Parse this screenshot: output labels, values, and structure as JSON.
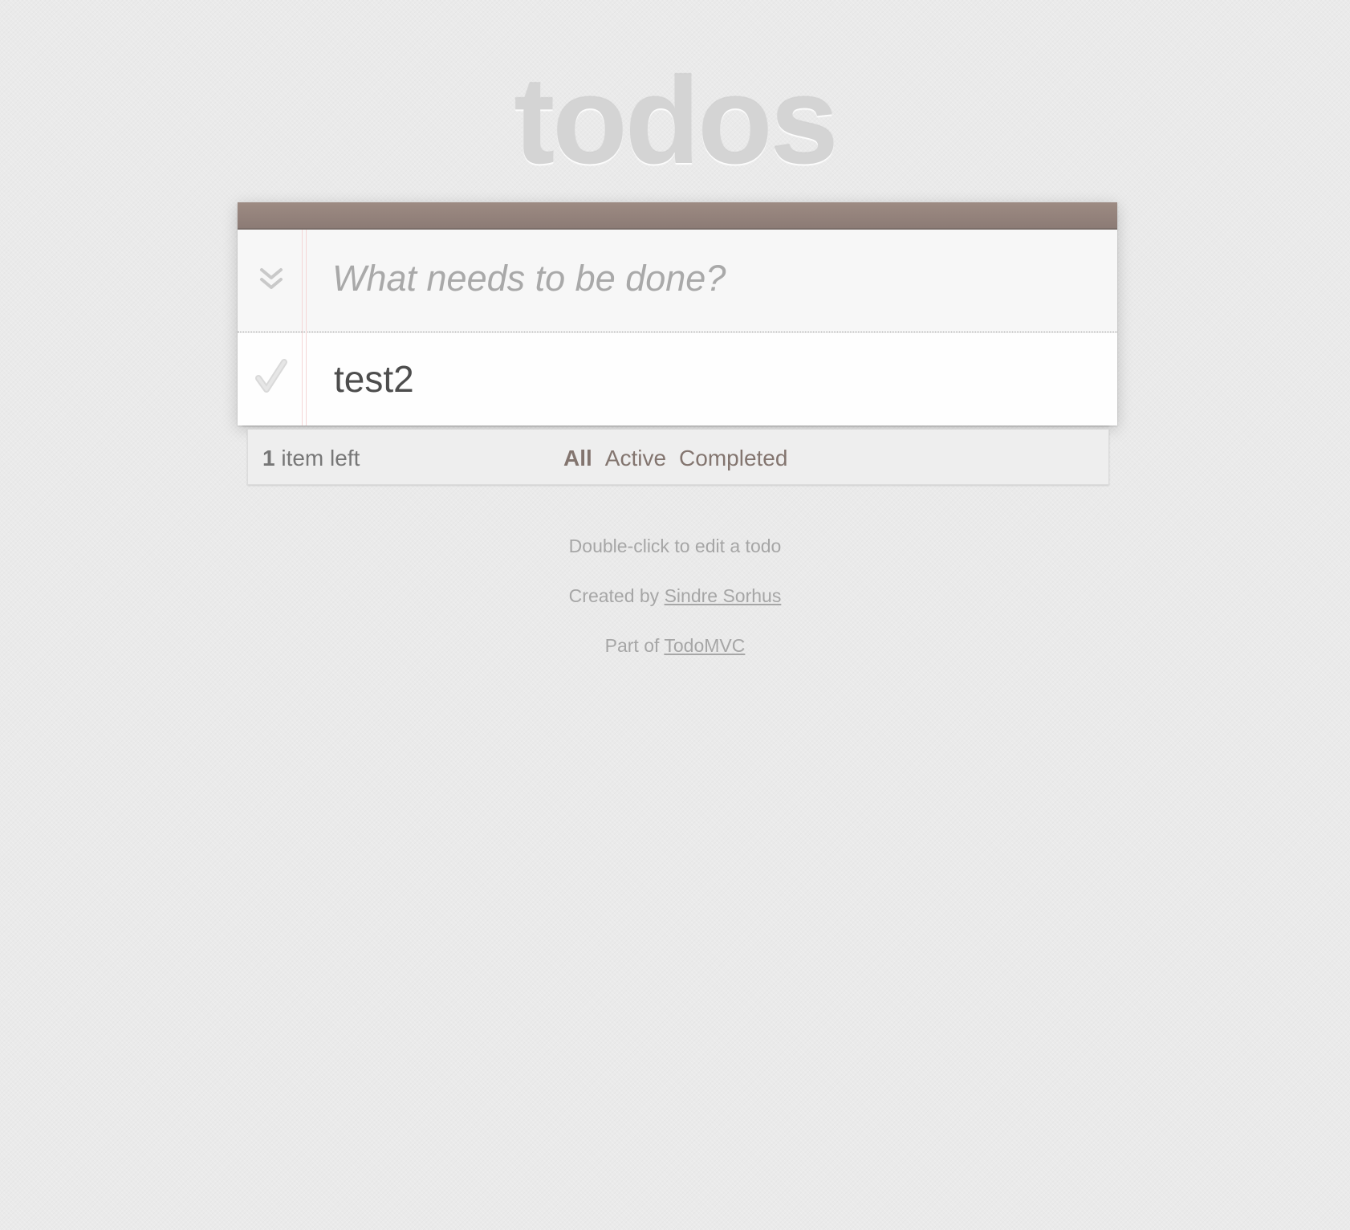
{
  "app": {
    "title": "todos"
  },
  "new_todo": {
    "placeholder": "What needs to be done?",
    "value": "",
    "toggle_all_icon": "double-chevron-down-icon"
  },
  "todos": [
    {
      "label": "test2",
      "completed": false,
      "toggle_icon": "checkmark-icon"
    }
  ],
  "footer": {
    "count": "1",
    "count_suffix": " item left",
    "filters": [
      {
        "label": "All",
        "selected": true
      },
      {
        "label": "Active",
        "selected": false
      },
      {
        "label": "Completed",
        "selected": false
      }
    ]
  },
  "info": {
    "edit_hint": "Double-click to edit a todo",
    "created_prefix": "Created by ",
    "created_link": "Sindre Sorhus",
    "part_prefix": "Part of ",
    "part_link": "TodoMVC"
  },
  "colors": {
    "header_bar": "#8c7b75",
    "title": "#d4d4d4",
    "filter_text": "#83756f",
    "margin_line": "#f5d6d6"
  }
}
